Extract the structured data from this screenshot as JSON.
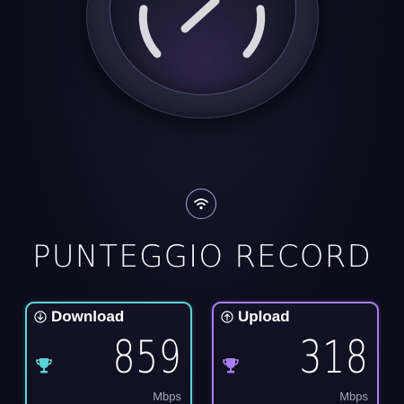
{
  "gauge": {
    "icon": "speedometer-icon"
  },
  "header": {
    "icon": "wifi-icon",
    "title": "PUNTEGGIO RECORD"
  },
  "cards": {
    "download": {
      "icon": "download-arrow-icon",
      "label": "Download",
      "value": "859",
      "unit": "Mbps",
      "trophy_icon": "trophy-icon",
      "accent": "#5bd4d6"
    },
    "upload": {
      "icon": "upload-arrow-icon",
      "label": "Upload",
      "value": "318",
      "unit": "Mbps",
      "trophy_icon": "trophy-icon",
      "accent": "#a77ff0"
    }
  },
  "colors": {
    "background": "#0c0c1b",
    "gauge_arc": "#d8d8de",
    "wifi_accent": "#a99be6"
  }
}
